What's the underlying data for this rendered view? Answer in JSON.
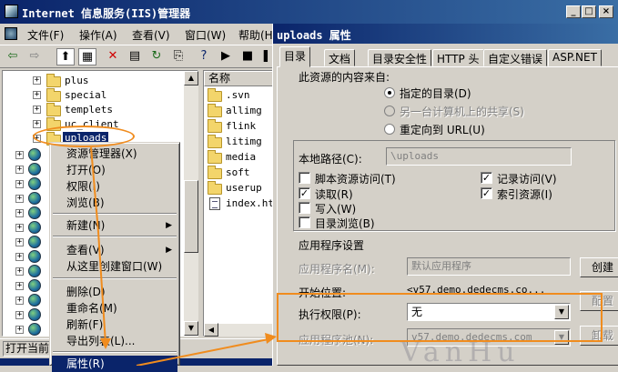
{
  "colors": {
    "accent": "#0a246a",
    "annotation": "#f08c1e",
    "face": "#d4d0c8"
  },
  "iis_window": {
    "title": "Internet 信息服务(IIS)管理器",
    "menu": [
      "文件(F)",
      "操作(A)",
      "查看(V)",
      "窗口(W)",
      "帮助(H)"
    ],
    "toolbar_icons": [
      "back-arrow-icon",
      "forward-arrow-icon",
      "up-folder-icon",
      "show-tree-icon",
      "delete-icon",
      "properties-icon",
      "refresh-icon",
      "export-icon",
      "help-icon",
      "play-icon",
      "stop-icon",
      "pause-icon"
    ],
    "tree": {
      "folders": [
        "plus",
        "special",
        "templets",
        "uc_client",
        "uploads"
      ],
      "selected": "uploads",
      "site_node_count": 13
    },
    "list": {
      "header": "名称",
      "items": [
        {
          "icon": "folder-icon",
          "name": ".svn"
        },
        {
          "icon": "folder-icon",
          "name": "allimg"
        },
        {
          "icon": "folder-icon",
          "name": "flink"
        },
        {
          "icon": "folder-icon",
          "name": "litimg"
        },
        {
          "icon": "folder-icon",
          "name": "media"
        },
        {
          "icon": "folder-icon",
          "name": "soft"
        },
        {
          "icon": "folder-icon",
          "name": "userup"
        },
        {
          "icon": "file-icon",
          "name": "index.ht"
        }
      ]
    },
    "status": "打开当前"
  },
  "context_menu": {
    "items": [
      {
        "label": "资源管理器(X)",
        "submenu": false
      },
      {
        "label": "打开(O)",
        "submenu": false
      },
      {
        "label": "权限(I)",
        "submenu": false
      },
      {
        "label": "浏览(B)",
        "submenu": false
      },
      {
        "sep": true
      },
      {
        "label": "新建(N)",
        "submenu": true
      },
      {
        "sep": true
      },
      {
        "label": "查看(V)",
        "submenu": true
      },
      {
        "label": "从这里创建窗口(W)",
        "submenu": false
      },
      {
        "sep": true
      },
      {
        "label": "删除(D)",
        "submenu": false
      },
      {
        "label": "重命名(M)",
        "submenu": false
      },
      {
        "label": "刷新(F)",
        "submenu": false
      },
      {
        "label": "导出列表(L)...",
        "submenu": false
      },
      {
        "sep": true
      },
      {
        "label": "属性(R)",
        "submenu": false,
        "highlighted": true
      }
    ]
  },
  "props_dialog": {
    "title": "uploads 属性",
    "tabs": [
      "目录",
      "文档",
      "目录安全性",
      "HTTP 头",
      "自定义错误",
      "ASP.NET"
    ],
    "active_tab": "目录",
    "source_label": "此资源的内容来自:",
    "source_options": [
      {
        "label": "指定的目录(D)",
        "checked": true,
        "enabled": true
      },
      {
        "label": "另一台计算机上的共享(S)",
        "checked": false,
        "enabled": false
      },
      {
        "label": "重定向到 URL(U)",
        "checked": false,
        "enabled": true
      }
    ],
    "local_path_label": "本地路径(C):",
    "local_path_value": "\\uploads",
    "checkboxes_left": [
      {
        "label": "脚本资源访问(T)",
        "checked": false
      },
      {
        "label": "读取(R)",
        "checked": true
      },
      {
        "label": "写入(W)",
        "checked": false
      },
      {
        "label": "目录浏览(B)",
        "checked": false
      }
    ],
    "checkboxes_right": [
      {
        "label": "记录访问(V)",
        "checked": true
      },
      {
        "label": "索引资源(I)",
        "checked": true
      }
    ],
    "app_settings_label": "应用程序设置",
    "app_name_label": "应用程序名(M):",
    "app_name_value": "默认应用程序",
    "start_point_label": "开始位置:",
    "start_point_value": "<v57.demo.dedecms.co...",
    "exec_perm_label": "执行权限(P):",
    "exec_perm_value": "无",
    "app_pool_label": "应用程序池(N):",
    "app_pool_value": "v57.demo.dedecms.com",
    "buttons": {
      "create": "创建",
      "config": "配置",
      "unload": "卸载"
    },
    "watermark": "VanHu"
  }
}
